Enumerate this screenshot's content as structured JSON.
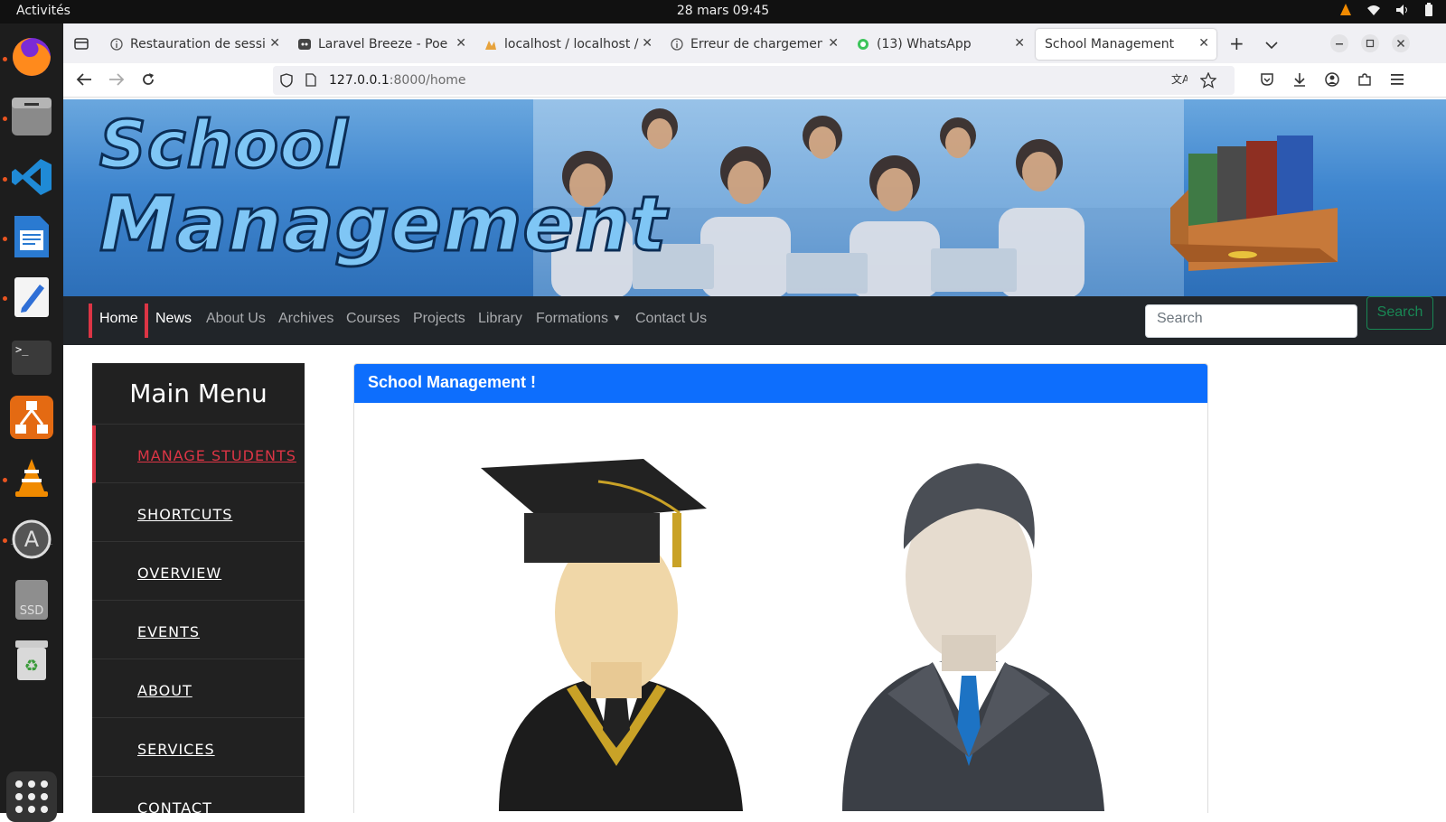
{
  "topbar": {
    "activities": "Activités",
    "clock": "28 mars  09:45"
  },
  "dock": {
    "apps": [
      "firefox-icon",
      "files-icon",
      "vscode-icon",
      "libreoffice-writer-icon",
      "text-editor-icon",
      "terminal-icon",
      "mysql-workbench-icon",
      "vlc-icon",
      "software-updater-icon",
      "ssd-drive-icon",
      "trash-icon"
    ]
  },
  "browser": {
    "tabs": [
      {
        "label": "Restauration de session",
        "icon": "info-icon"
      },
      {
        "label": "Laravel Breeze - Poe",
        "icon": "poe-icon"
      },
      {
        "label": "localhost / localhost / C",
        "icon": "phpmyadmin-icon"
      },
      {
        "label": "Erreur de chargement d",
        "icon": "info-icon"
      },
      {
        "label": "(13) WhatsApp",
        "icon": "whatsapp-icon"
      },
      {
        "label": "School Management",
        "icon": ""
      }
    ],
    "url_host": "127.0.0.1",
    "url_path": ":8000/home"
  },
  "site": {
    "logo_line1": "School",
    "logo_line2": "Management",
    "nav": {
      "home": "Home",
      "news": "News",
      "about": "About Us",
      "archives": "Archives",
      "courses": "Courses",
      "projects": "Projects",
      "library": "Library",
      "formations": "Formations",
      "contact": "Contact Us"
    },
    "search_placeholder": "Search",
    "search_button": "Search",
    "sidebar": {
      "title": "Main Menu",
      "items": [
        "MANAGE STUDENTS",
        "SHORTCUTS",
        "OVERVIEW",
        "EVENTS",
        "ABOUT",
        "SERVICES",
        "CONTACT"
      ]
    },
    "card_title": "School Management !"
  },
  "colors": {
    "navbar_bg": "#212529",
    "accent_red": "#dc3545",
    "card_header": "#0d6efd",
    "search_green": "#198754"
  }
}
